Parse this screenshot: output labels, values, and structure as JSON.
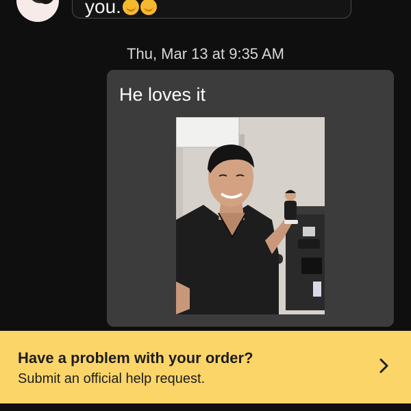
{
  "previous_message": {
    "text": "you.",
    "emojis": [
      "grinning-face-emoji",
      "grinning-face-emoji"
    ]
  },
  "timestamp": "Thu, Mar 13 at 9:35 AM",
  "message": {
    "text": "He loves it",
    "photo": "photo of man in black scrubs holding a custom bobblehead figurine"
  },
  "help_banner": {
    "title": "Have a problem with your order?",
    "subtitle": "Submit an official help request.",
    "chevron": "chevron-right-icon"
  },
  "colors": {
    "background": "#0f0f0f",
    "bubble": "#3c3c3c",
    "banner": "#fcd569",
    "banner_text": "#1d1d1d",
    "timestamp_text": "#d8d8d8"
  }
}
